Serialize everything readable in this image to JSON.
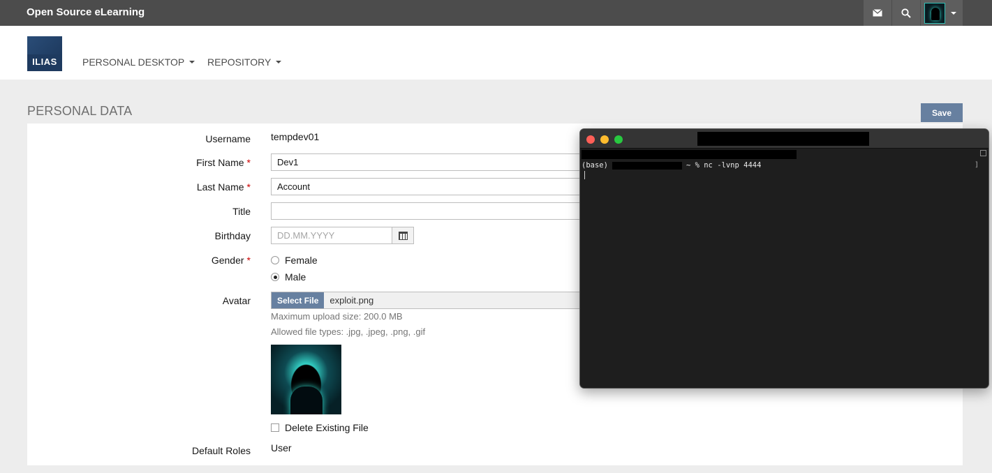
{
  "topbar": {
    "site_title": "Open Source eLearning"
  },
  "header": {
    "logo_text": "ILIAS",
    "nav": [
      {
        "label": "PERSONAL DESKTOP"
      },
      {
        "label": "REPOSITORY"
      }
    ]
  },
  "page": {
    "title": "PERSONAL DATA",
    "save_label": "Save"
  },
  "form": {
    "username": {
      "label": "Username",
      "value": "tempdev01"
    },
    "first_name": {
      "label": "First Name",
      "value": "Dev1"
    },
    "last_name": {
      "label": "Last Name",
      "value": "Account"
    },
    "title": {
      "label": "Title",
      "value": ""
    },
    "birthday": {
      "label": "Birthday",
      "placeholder": "DD.MM.YYYY"
    },
    "gender": {
      "label": "Gender",
      "options": [
        "Female",
        "Male"
      ],
      "selected": "Male"
    },
    "avatar": {
      "label": "Avatar",
      "select_label": "Select File",
      "file_name": "exploit.png",
      "max_size": "Maximum upload size: 200.0 MB",
      "allowed_types": "Allowed file types: .jpg, .jpeg, .png, .gif",
      "delete_label": "Delete Existing File"
    },
    "default_roles": {
      "label": "Default Roles",
      "value": "User"
    },
    "required_marker": "*"
  },
  "terminal": {
    "prompt_prefix": "(base)",
    "prompt_suffix": "~ % nc -lvnp 4444"
  }
}
